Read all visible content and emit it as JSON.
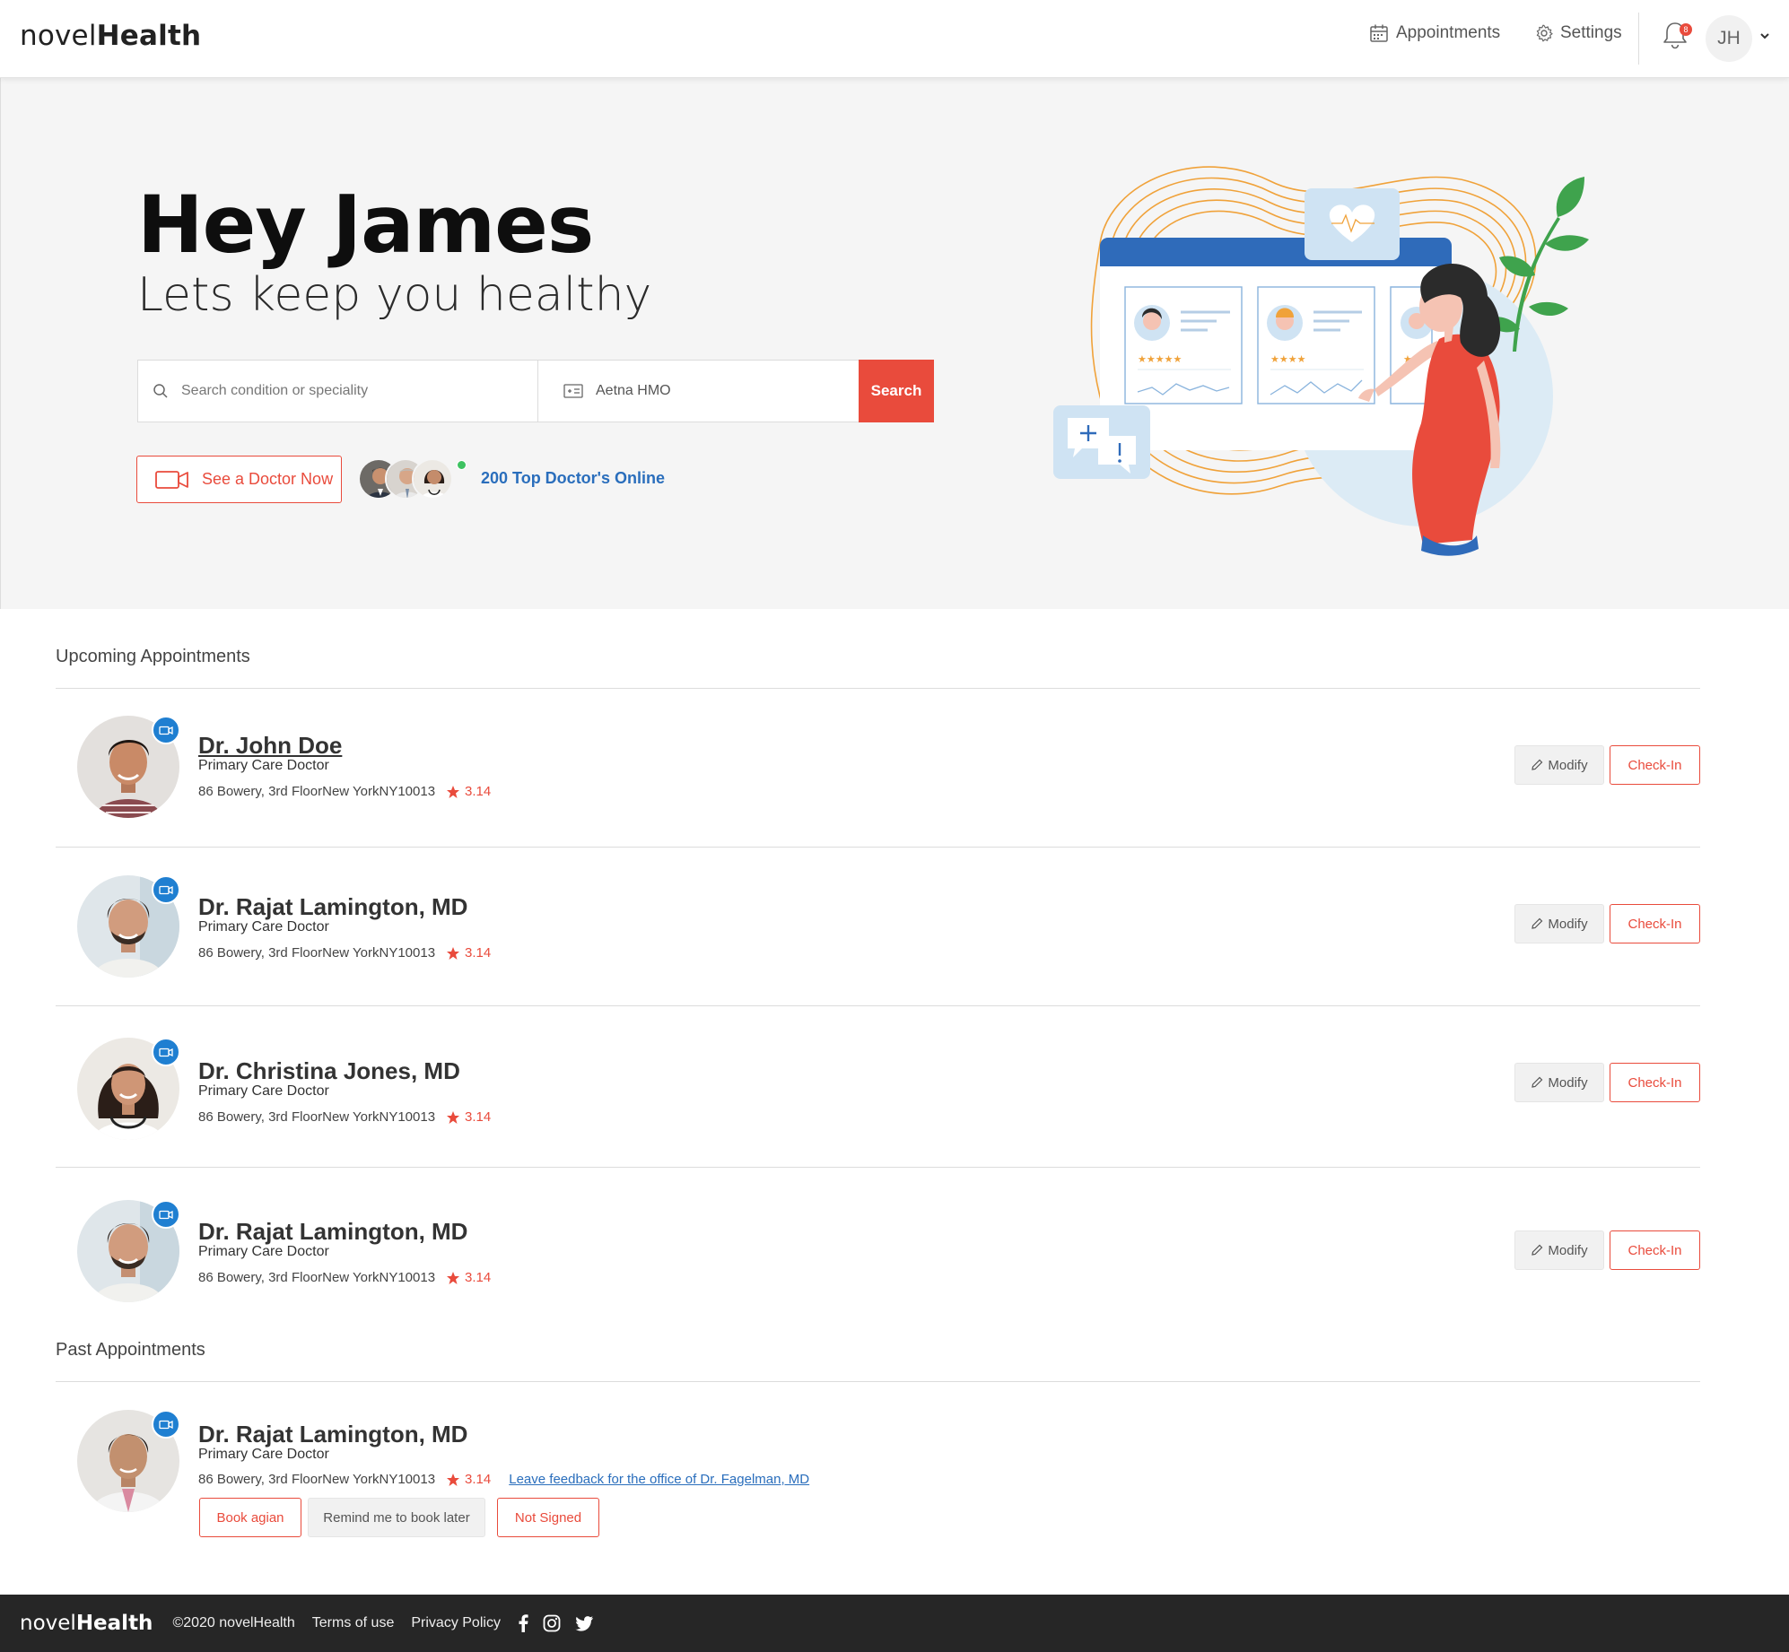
{
  "header": {
    "logo_light": "novel",
    "logo_bold": "Health",
    "appointments_label": "Appointments",
    "settings_label": "Settings",
    "notification_count": "8",
    "user_initials": "JH"
  },
  "hero": {
    "title": "Hey James",
    "subtitle": "Lets keep you healthy",
    "search_placeholder": "Search condition or speciality",
    "insurance_value": "Aetna HMO",
    "search_button": "Search",
    "see_doctor_label": "See a Doctor Now",
    "online_doctors_label": "200 Top Doctor's Online"
  },
  "upcoming": {
    "title": "Upcoming Appointments",
    "items": [
      {
        "name": "Dr. John Doe",
        "specialty": "Primary Care Doctor",
        "address": "86 Bowery, 3rd FloorNew YorkNY10013",
        "rating": "3.14",
        "modify": "Modify",
        "checkin": "Check-In"
      },
      {
        "name": "Dr. Rajat Lamington, MD",
        "specialty": "Primary Care Doctor",
        "address": "86 Bowery, 3rd FloorNew YorkNY10013",
        "rating": "3.14",
        "modify": "Modify",
        "checkin": "Check-In"
      },
      {
        "name": "Dr. Christina Jones, MD",
        "specialty": "Primary Care Doctor",
        "address": "86 Bowery, 3rd FloorNew YorkNY10013",
        "rating": "3.14",
        "modify": "Modify",
        "checkin": "Check-In"
      },
      {
        "name": "Dr. Rajat Lamington, MD",
        "specialty": "Primary Care Doctor",
        "address": "86 Bowery, 3rd FloorNew YorkNY10013",
        "rating": "3.14",
        "modify": "Modify",
        "checkin": "Check-In"
      }
    ]
  },
  "past": {
    "title": "Past Appointments",
    "items": [
      {
        "name": "Dr. Rajat Lamington, MD",
        "specialty": "Primary Care Doctor",
        "address": "86 Bowery, 3rd FloorNew YorkNY10013",
        "rating": "3.14",
        "feedback_link": "Leave feedback for the office of Dr. Fagelman, MD",
        "book_again": "Book agian",
        "remind_later": "Remind me to book later",
        "not_signed": "Not Signed"
      }
    ]
  },
  "footer": {
    "logo_light": "novel",
    "logo_bold": "Health",
    "copyright": "©2020 novelHealth",
    "terms": "Terms of use",
    "privacy": "Privacy Policy"
  },
  "colors": {
    "accent_red": "#e94b3c",
    "link_blue": "#2a6ebc",
    "video_badge_blue": "#1f7fd1",
    "hero_background": "#f5f5f5",
    "footer_background": "#262626"
  }
}
